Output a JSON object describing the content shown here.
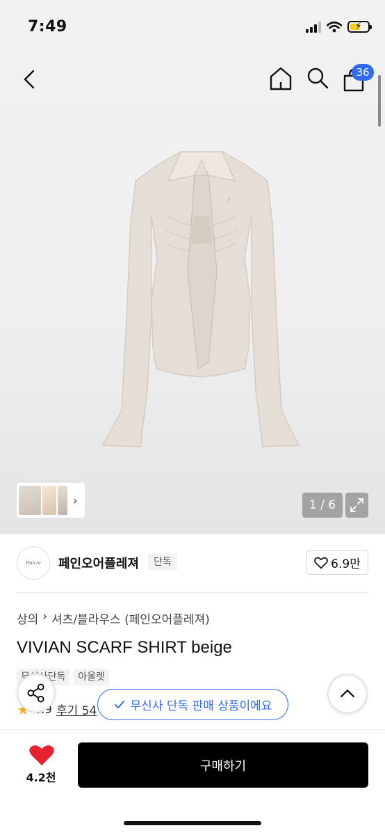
{
  "status_bar": {
    "time": "7:49"
  },
  "nav": {
    "cart_count": "36"
  },
  "gallery": {
    "counter": "1 / 6",
    "thumb_arrow": "›"
  },
  "brand": {
    "logo_text": "Pain or pleasure",
    "name": "페인오어플레져",
    "tag": "단독",
    "likes": "6.9만"
  },
  "product": {
    "breadcrumb": [
      "상의",
      "셔츠/블라우스 (페인오어플레져)"
    ],
    "title": "VIVIAN SCARF SHIRT beige",
    "tags": [
      "무신사단독",
      "아울렛"
    ],
    "rating": "4.9",
    "review_label": "후기 54"
  },
  "banner": {
    "exclusive_text": "무신사 단독 판매 상품이에요"
  },
  "bottom": {
    "like_count": "4.2천",
    "buy_label": "구매하기"
  },
  "colors": {
    "accent_blue": "#2f6bf3",
    "heart_red": "#e8232f",
    "buy_bg": "#000000",
    "star": "#f6b21b"
  }
}
